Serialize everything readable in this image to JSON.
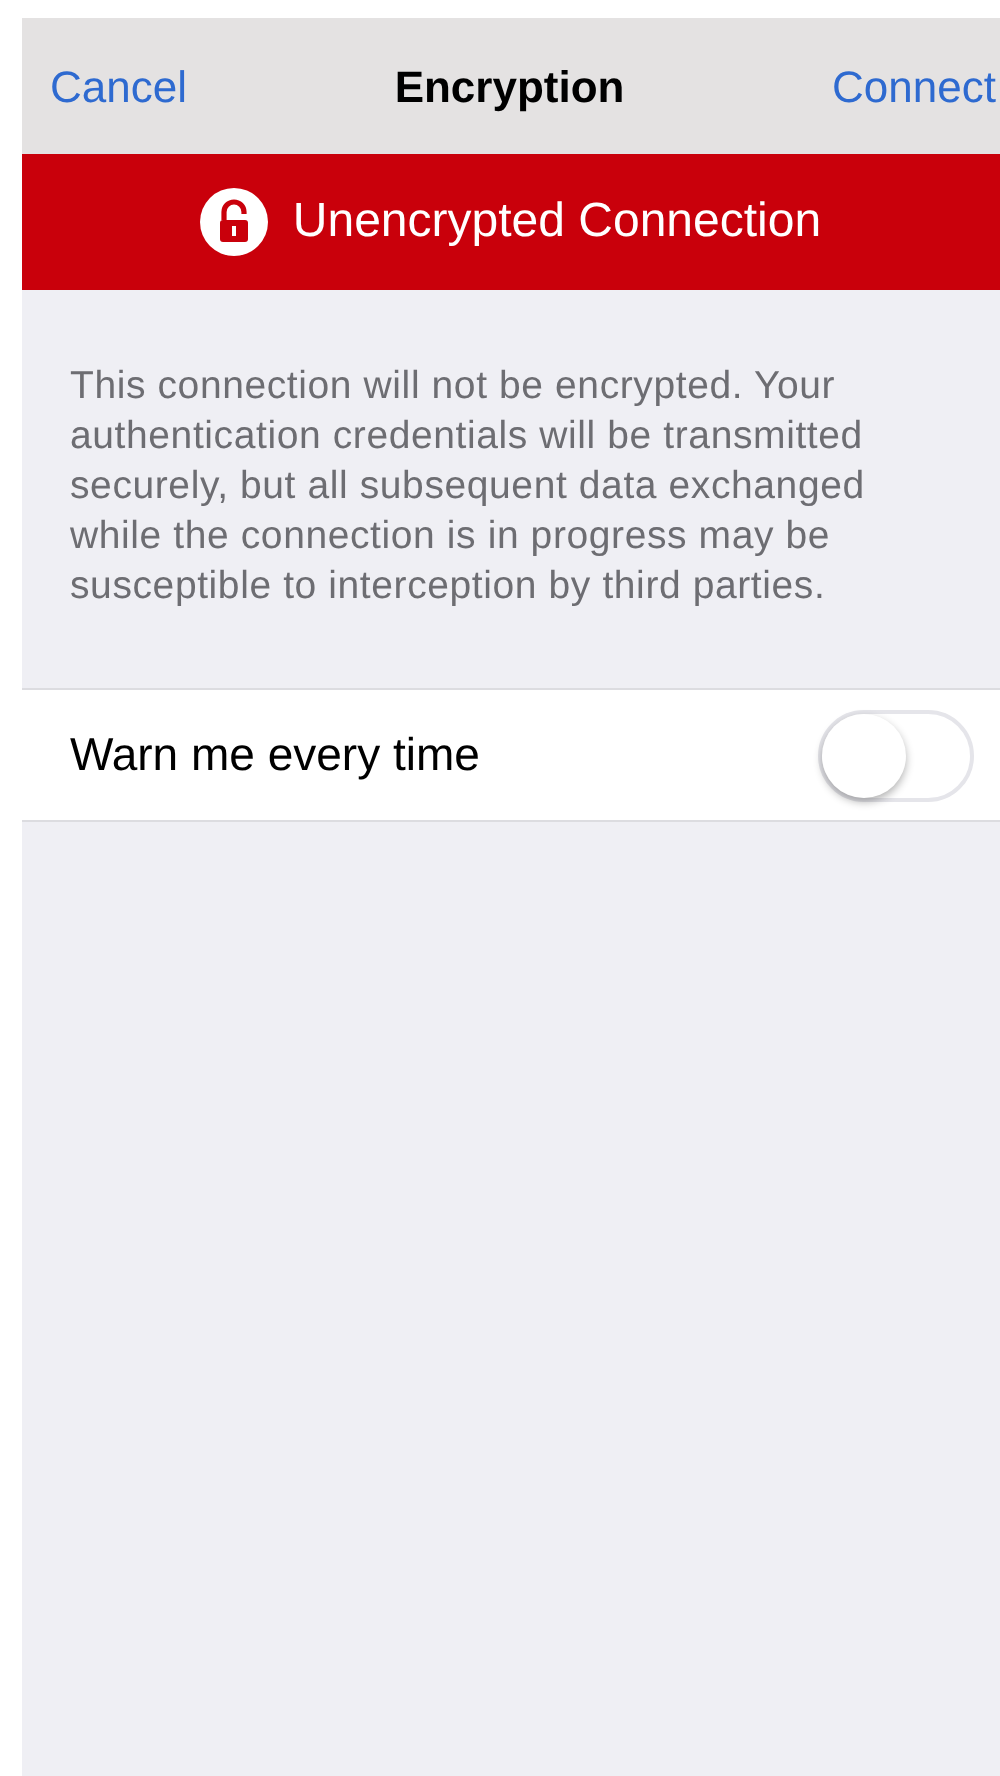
{
  "nav_bar": {
    "left_button": "Cancel",
    "title": "Encryption",
    "right_button": "Connect"
  },
  "banner": {
    "text": "Unencrypted Connection"
  },
  "description": "This connection will not be encrypted. Your authentication credentials will be transmitted securely, but all subsequent data exchanged while the connection is in progress may be susceptible to interception by third parties.",
  "settings": [
    {
      "label": "Warn me every time",
      "on": false
    }
  ]
}
